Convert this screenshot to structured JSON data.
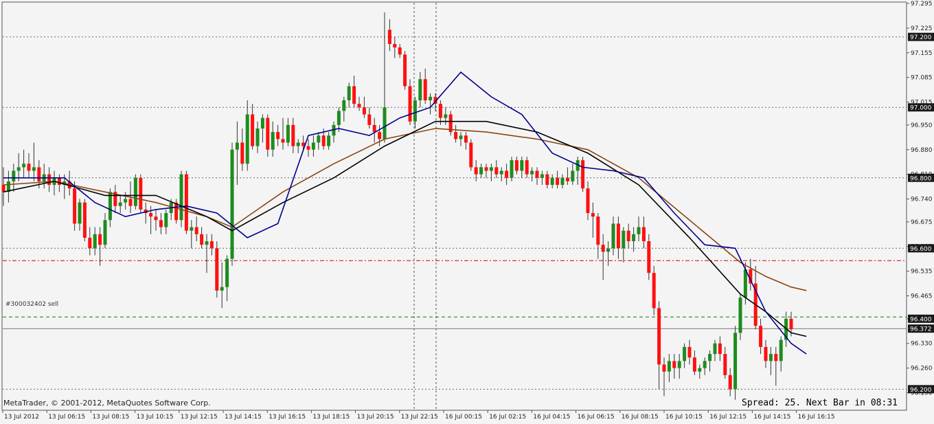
{
  "footer": {
    "copyright": "MetaTrader, © 2001-2012, MetaQuotes Software Corp.",
    "spread_status": "Spread: 25. Next Bar in 08:31"
  },
  "order_label": "#300032402 sell",
  "colors": {
    "background": "#f4f4f4",
    "bull_candle": "#1e8c1e",
    "bear_candle": "#ff1010",
    "ma_fast": "#00008b",
    "ma_slow": "#000000",
    "ma_brown": "#8b4513",
    "order_line": "#d00000",
    "sl_line": "#008000",
    "price_label_bg": "#1a1a1a"
  },
  "chart_data": {
    "type": "candlestick",
    "symbol_timeframe": "M15",
    "y_axis": {
      "min": 96.15,
      "max": 97.295,
      "ticks": [
        97.295,
        97.225,
        97.155,
        97.085,
        97.015,
        96.95,
        96.88,
        96.81,
        96.74,
        96.675,
        96.605,
        96.535,
        96.465,
        96.4,
        96.33,
        96.26,
        96.19
      ]
    },
    "price_labels": [
      {
        "value": "97.200",
        "level": 97.2
      },
      {
        "value": "97.000",
        "level": 97.0
      },
      {
        "value": "96.800",
        "level": 96.8
      },
      {
        "value": "96.600",
        "level": 96.6
      },
      {
        "value": "96.400",
        "level": 96.4
      },
      {
        "value": "96.372",
        "level": 96.372
      },
      {
        "value": "96.200",
        "level": 96.2
      }
    ],
    "horizontal_lines": [
      {
        "level": 97.2,
        "style": "dotted-gray"
      },
      {
        "level": 97.0,
        "style": "dotted-gray"
      },
      {
        "level": 96.8,
        "style": "dotted-gray"
      },
      {
        "level": 96.6,
        "style": "dotted-gray"
      },
      {
        "level": 96.565,
        "style": "dashdot-red"
      },
      {
        "level": 96.405,
        "style": "dashed-green"
      },
      {
        "level": 96.372,
        "style": "solid-gray"
      },
      {
        "level": 96.2,
        "style": "dotted-gray"
      }
    ],
    "x_labels": [
      "13 Jul 2012",
      "13 Jul 06:15",
      "13 Jul 08:15",
      "13 Jul 10:15",
      "13 Jul 12:15",
      "13 Jul 14:15",
      "13 Jul 16:15",
      "13 Jul 18:15",
      "13 Jul 20:15",
      "13 Jul 22:15",
      "16 Jul 00:15",
      "16 Jul 02:15",
      "16 Jul 04:15",
      "16 Jul 06:15",
      "16 Jul 08:15",
      "16 Jul 10:15",
      "16 Jul 12:15",
      "16 Jul 14:15",
      "16 Jul 16:15"
    ],
    "candles": [
      {
        "o": 96.78,
        "h": 96.83,
        "l": 96.72,
        "c": 96.76
      },
      {
        "o": 96.76,
        "h": 96.82,
        "l": 96.73,
        "c": 96.79
      },
      {
        "o": 96.79,
        "h": 96.84,
        "l": 96.76,
        "c": 96.82
      },
      {
        "o": 96.82,
        "h": 96.87,
        "l": 96.79,
        "c": 96.83
      },
      {
        "o": 96.83,
        "h": 96.88,
        "l": 96.8,
        "c": 96.84
      },
      {
        "o": 96.84,
        "h": 96.87,
        "l": 96.8,
        "c": 96.82
      },
      {
        "o": 96.82,
        "h": 96.9,
        "l": 96.79,
        "c": 96.83
      },
      {
        "o": 96.83,
        "h": 96.85,
        "l": 96.77,
        "c": 96.79
      },
      {
        "o": 96.79,
        "h": 96.84,
        "l": 96.77,
        "c": 96.81
      },
      {
        "o": 96.81,
        "h": 96.83,
        "l": 96.76,
        "c": 96.78
      },
      {
        "o": 96.78,
        "h": 96.82,
        "l": 96.75,
        "c": 96.8
      },
      {
        "o": 96.8,
        "h": 96.81,
        "l": 96.76,
        "c": 96.78
      },
      {
        "o": 96.78,
        "h": 96.81,
        "l": 96.74,
        "c": 96.79
      },
      {
        "o": 96.79,
        "h": 96.82,
        "l": 96.75,
        "c": 96.77
      },
      {
        "o": 96.77,
        "h": 96.79,
        "l": 96.65,
        "c": 96.67
      },
      {
        "o": 96.67,
        "h": 96.74,
        "l": 96.65,
        "c": 96.73
      },
      {
        "o": 96.73,
        "h": 96.74,
        "l": 96.62,
        "c": 96.63
      },
      {
        "o": 96.63,
        "h": 96.66,
        "l": 96.58,
        "c": 96.6
      },
      {
        "o": 96.6,
        "h": 96.66,
        "l": 96.58,
        "c": 96.64
      },
      {
        "o": 96.64,
        "h": 96.66,
        "l": 96.55,
        "c": 96.61
      },
      {
        "o": 96.61,
        "h": 96.7,
        "l": 96.6,
        "c": 96.68
      },
      {
        "o": 96.68,
        "h": 96.77,
        "l": 96.66,
        "c": 96.76
      },
      {
        "o": 96.76,
        "h": 96.78,
        "l": 96.7,
        "c": 96.72
      },
      {
        "o": 96.72,
        "h": 96.75,
        "l": 96.7,
        "c": 96.73
      },
      {
        "o": 96.73,
        "h": 96.76,
        "l": 96.71,
        "c": 96.74
      },
      {
        "o": 96.74,
        "h": 96.79,
        "l": 96.7,
        "c": 96.72
      },
      {
        "o": 96.72,
        "h": 96.81,
        "l": 96.71,
        "c": 96.8
      },
      {
        "o": 96.8,
        "h": 96.81,
        "l": 96.7,
        "c": 96.71
      },
      {
        "o": 96.71,
        "h": 96.73,
        "l": 96.67,
        "c": 96.7
      },
      {
        "o": 96.7,
        "h": 96.72,
        "l": 96.64,
        "c": 96.69
      },
      {
        "o": 96.69,
        "h": 96.71,
        "l": 96.65,
        "c": 96.68
      },
      {
        "o": 96.68,
        "h": 96.7,
        "l": 96.64,
        "c": 96.66
      },
      {
        "o": 96.66,
        "h": 96.71,
        "l": 96.64,
        "c": 96.7
      },
      {
        "o": 96.7,
        "h": 96.74,
        "l": 96.68,
        "c": 96.73
      },
      {
        "o": 96.73,
        "h": 96.74,
        "l": 96.67,
        "c": 96.68
      },
      {
        "o": 96.68,
        "h": 96.82,
        "l": 96.66,
        "c": 96.81
      },
      {
        "o": 96.81,
        "h": 96.82,
        "l": 96.64,
        "c": 96.65
      },
      {
        "o": 96.65,
        "h": 96.68,
        "l": 96.6,
        "c": 96.66
      },
      {
        "o": 96.66,
        "h": 96.69,
        "l": 96.62,
        "c": 96.64
      },
      {
        "o": 96.64,
        "h": 96.66,
        "l": 96.6,
        "c": 96.61
      },
      {
        "o": 96.61,
        "h": 96.64,
        "l": 96.53,
        "c": 96.62
      },
      {
        "o": 96.62,
        "h": 96.64,
        "l": 96.58,
        "c": 96.6
      },
      {
        "o": 96.6,
        "h": 96.62,
        "l": 96.46,
        "c": 96.48
      },
      {
        "o": 96.48,
        "h": 96.56,
        "l": 96.43,
        "c": 96.49
      },
      {
        "o": 96.49,
        "h": 96.58,
        "l": 96.45,
        "c": 96.57
      },
      {
        "o": 96.57,
        "h": 96.9,
        "l": 96.55,
        "c": 96.88
      },
      {
        "o": 96.88,
        "h": 96.96,
        "l": 96.78,
        "c": 96.9
      },
      {
        "o": 96.9,
        "h": 96.94,
        "l": 96.82,
        "c": 96.84
      },
      {
        "o": 96.84,
        "h": 97.02,
        "l": 96.82,
        "c": 96.98
      },
      {
        "o": 96.98,
        "h": 97.01,
        "l": 96.88,
        "c": 96.89
      },
      {
        "o": 96.89,
        "h": 96.96,
        "l": 96.87,
        "c": 96.94
      },
      {
        "o": 96.94,
        "h": 96.98,
        "l": 96.9,
        "c": 96.97
      },
      {
        "o": 96.97,
        "h": 96.98,
        "l": 96.86,
        "c": 96.88
      },
      {
        "o": 96.88,
        "h": 96.96,
        "l": 96.86,
        "c": 96.93
      },
      {
        "o": 96.93,
        "h": 96.95,
        "l": 96.89,
        "c": 96.91
      },
      {
        "o": 96.91,
        "h": 96.97,
        "l": 96.88,
        "c": 96.9
      },
      {
        "o": 96.9,
        "h": 96.97,
        "l": 96.89,
        "c": 96.95
      },
      {
        "o": 96.95,
        "h": 96.97,
        "l": 96.87,
        "c": 96.89
      },
      {
        "o": 96.89,
        "h": 96.91,
        "l": 96.87,
        "c": 96.9
      },
      {
        "o": 96.9,
        "h": 96.92,
        "l": 96.88,
        "c": 96.89
      },
      {
        "o": 96.89,
        "h": 96.91,
        "l": 96.86,
        "c": 96.88
      },
      {
        "o": 96.88,
        "h": 96.92,
        "l": 96.86,
        "c": 96.9
      },
      {
        "o": 96.9,
        "h": 96.93,
        "l": 96.88,
        "c": 96.92
      },
      {
        "o": 96.92,
        "h": 96.94,
        "l": 96.88,
        "c": 96.89
      },
      {
        "o": 96.89,
        "h": 96.93,
        "l": 96.88,
        "c": 96.92
      },
      {
        "o": 96.92,
        "h": 96.96,
        "l": 96.9,
        "c": 96.95
      },
      {
        "o": 96.95,
        "h": 97.0,
        "l": 96.93,
        "c": 96.99
      },
      {
        "o": 96.99,
        "h": 97.03,
        "l": 96.96,
        "c": 97.02
      },
      {
        "o": 97.02,
        "h": 97.07,
        "l": 97.0,
        "c": 97.06
      },
      {
        "o": 97.06,
        "h": 97.09,
        "l": 97.0,
        "c": 97.01
      },
      {
        "o": 97.01,
        "h": 97.03,
        "l": 96.99,
        "c": 97.0
      },
      {
        "o": 97.0,
        "h": 97.03,
        "l": 96.97,
        "c": 96.98
      },
      {
        "o": 96.98,
        "h": 97.0,
        "l": 96.94,
        "c": 96.95
      },
      {
        "o": 96.95,
        "h": 96.97,
        "l": 96.9,
        "c": 96.93
      },
      {
        "o": 96.93,
        "h": 96.95,
        "l": 96.89,
        "c": 96.91
      },
      {
        "o": 96.91,
        "h": 97.27,
        "l": 96.9,
        "c": 97.0
      },
      {
        "o": 97.22,
        "h": 97.25,
        "l": 97.16,
        "c": 97.18
      },
      {
        "o": 97.18,
        "h": 97.2,
        "l": 97.14,
        "c": 97.17
      },
      {
        "o": 97.17,
        "h": 97.18,
        "l": 97.14,
        "c": 97.15
      },
      {
        "o": 97.15,
        "h": 97.16,
        "l": 97.05,
        "c": 97.06
      },
      {
        "o": 97.06,
        "h": 97.08,
        "l": 96.95,
        "c": 96.96
      },
      {
        "o": 96.96,
        "h": 97.03,
        "l": 96.94,
        "c": 97.02
      },
      {
        "o": 97.02,
        "h": 97.1,
        "l": 97.0,
        "c": 97.08
      },
      {
        "o": 97.08,
        "h": 97.11,
        "l": 97.01,
        "c": 97.02
      },
      {
        "o": 97.02,
        "h": 97.04,
        "l": 96.98,
        "c": 97.03
      },
      {
        "o": 97.03,
        "h": 97.04,
        "l": 96.99,
        "c": 97.01
      },
      {
        "o": 97.01,
        "h": 97.02,
        "l": 96.95,
        "c": 96.97
      },
      {
        "o": 96.97,
        "h": 97.0,
        "l": 96.95,
        "c": 96.98
      },
      {
        "o": 96.98,
        "h": 96.99,
        "l": 96.92,
        "c": 96.93
      },
      {
        "o": 96.93,
        "h": 96.95,
        "l": 96.9,
        "c": 96.91
      },
      {
        "o": 96.91,
        "h": 96.93,
        "l": 96.89,
        "c": 96.92
      },
      {
        "o": 96.92,
        "h": 96.93,
        "l": 96.88,
        "c": 96.9
      },
      {
        "o": 96.9,
        "h": 96.91,
        "l": 96.82,
        "c": 96.83
      },
      {
        "o": 96.83,
        "h": 96.85,
        "l": 96.79,
        "c": 96.81
      },
      {
        "o": 96.81,
        "h": 96.84,
        "l": 96.8,
        "c": 96.83
      },
      {
        "o": 96.83,
        "h": 96.84,
        "l": 96.8,
        "c": 96.82
      },
      {
        "o": 96.82,
        "h": 96.84,
        "l": 96.79,
        "c": 96.83
      },
      {
        "o": 96.83,
        "h": 96.85,
        "l": 96.8,
        "c": 96.81
      },
      {
        "o": 96.81,
        "h": 96.83,
        "l": 96.79,
        "c": 96.82
      },
      {
        "o": 96.82,
        "h": 96.84,
        "l": 96.78,
        "c": 96.8
      },
      {
        "o": 96.8,
        "h": 96.86,
        "l": 96.79,
        "c": 96.85
      },
      {
        "o": 96.85,
        "h": 96.86,
        "l": 96.81,
        "c": 96.82
      },
      {
        "o": 96.82,
        "h": 96.86,
        "l": 96.8,
        "c": 96.85
      },
      {
        "o": 96.85,
        "h": 96.86,
        "l": 96.8,
        "c": 96.81
      },
      {
        "o": 96.81,
        "h": 96.83,
        "l": 96.79,
        "c": 96.82
      },
      {
        "o": 96.82,
        "h": 96.83,
        "l": 96.78,
        "c": 96.8
      },
      {
        "o": 96.8,
        "h": 96.82,
        "l": 96.78,
        "c": 96.81
      },
      {
        "o": 96.81,
        "h": 96.82,
        "l": 96.77,
        "c": 96.78
      },
      {
        "o": 96.78,
        "h": 96.81,
        "l": 96.77,
        "c": 96.8
      },
      {
        "o": 96.8,
        "h": 96.82,
        "l": 96.77,
        "c": 96.78
      },
      {
        "o": 96.78,
        "h": 96.81,
        "l": 96.77,
        "c": 96.8
      },
      {
        "o": 96.8,
        "h": 96.83,
        "l": 96.78,
        "c": 96.79
      },
      {
        "o": 96.79,
        "h": 96.84,
        "l": 96.78,
        "c": 96.82
      },
      {
        "o": 96.82,
        "h": 96.86,
        "l": 96.78,
        "c": 96.85
      },
      {
        "o": 96.85,
        "h": 96.86,
        "l": 96.76,
        "c": 96.77
      },
      {
        "o": 96.77,
        "h": 96.79,
        "l": 96.68,
        "c": 96.7
      },
      {
        "o": 96.7,
        "h": 96.73,
        "l": 96.63,
        "c": 96.69
      },
      {
        "o": 96.69,
        "h": 96.7,
        "l": 96.57,
        "c": 96.61
      },
      {
        "o": 96.61,
        "h": 96.64,
        "l": 96.51,
        "c": 96.59
      },
      {
        "o": 96.59,
        "h": 96.62,
        "l": 96.55,
        "c": 96.6
      },
      {
        "o": 96.6,
        "h": 96.69,
        "l": 96.58,
        "c": 96.67
      },
      {
        "o": 96.67,
        "h": 96.69,
        "l": 96.57,
        "c": 96.6
      },
      {
        "o": 96.6,
        "h": 96.66,
        "l": 96.56,
        "c": 96.65
      },
      {
        "o": 96.65,
        "h": 96.67,
        "l": 96.6,
        "c": 96.62
      },
      {
        "o": 96.62,
        "h": 96.66,
        "l": 96.59,
        "c": 96.64
      },
      {
        "o": 96.64,
        "h": 96.69,
        "l": 96.62,
        "c": 96.66
      },
      {
        "o": 96.66,
        "h": 96.69,
        "l": 96.6,
        "c": 96.62
      },
      {
        "o": 96.62,
        "h": 96.64,
        "l": 96.51,
        "c": 96.53
      },
      {
        "o": 96.53,
        "h": 96.55,
        "l": 96.41,
        "c": 96.43
      },
      {
        "o": 96.43,
        "h": 96.45,
        "l": 96.2,
        "c": 96.27
      },
      {
        "o": 96.27,
        "h": 96.29,
        "l": 96.18,
        "c": 96.25
      },
      {
        "o": 96.25,
        "h": 96.3,
        "l": 96.22,
        "c": 96.28
      },
      {
        "o": 96.28,
        "h": 96.3,
        "l": 96.23,
        "c": 96.26
      },
      {
        "o": 96.26,
        "h": 96.3,
        "l": 96.23,
        "c": 96.28
      },
      {
        "o": 96.28,
        "h": 96.33,
        "l": 96.26,
        "c": 96.32
      },
      {
        "o": 96.32,
        "h": 96.34,
        "l": 96.27,
        "c": 96.29
      },
      {
        "o": 96.29,
        "h": 96.31,
        "l": 96.24,
        "c": 96.25
      },
      {
        "o": 96.25,
        "h": 96.27,
        "l": 96.23,
        "c": 96.26
      },
      {
        "o": 96.26,
        "h": 96.29,
        "l": 96.24,
        "c": 96.28
      },
      {
        "o": 96.28,
        "h": 96.31,
        "l": 96.25,
        "c": 96.3
      },
      {
        "o": 96.3,
        "h": 96.34,
        "l": 96.28,
        "c": 96.33
      },
      {
        "o": 96.33,
        "h": 96.35,
        "l": 96.28,
        "c": 96.3
      },
      {
        "o": 96.3,
        "h": 96.32,
        "l": 96.23,
        "c": 96.24
      },
      {
        "o": 96.24,
        "h": 96.26,
        "l": 96.18,
        "c": 96.2
      },
      {
        "o": 96.2,
        "h": 96.38,
        "l": 96.17,
        "c": 96.36
      },
      {
        "o": 96.36,
        "h": 96.47,
        "l": 96.34,
        "c": 96.46
      },
      {
        "o": 96.46,
        "h": 96.56,
        "l": 96.44,
        "c": 96.54
      },
      {
        "o": 96.54,
        "h": 96.57,
        "l": 96.48,
        "c": 96.5
      },
      {
        "o": 96.5,
        "h": 96.55,
        "l": 96.37,
        "c": 96.38
      },
      {
        "o": 96.38,
        "h": 96.4,
        "l": 96.3,
        "c": 96.32
      },
      {
        "o": 96.32,
        "h": 96.34,
        "l": 96.26,
        "c": 96.28
      },
      {
        "o": 96.28,
        "h": 96.32,
        "l": 96.24,
        "c": 96.3
      },
      {
        "o": 96.3,
        "h": 96.32,
        "l": 96.21,
        "c": 96.28
      },
      {
        "o": 96.28,
        "h": 96.35,
        "l": 96.25,
        "c": 96.34
      },
      {
        "o": 96.34,
        "h": 96.42,
        "l": 96.32,
        "c": 96.4
      },
      {
        "o": 96.4,
        "h": 96.42,
        "l": 96.35,
        "c": 96.37
      }
    ],
    "ma_fast_x": [
      0,
      6,
      12,
      18,
      24,
      30,
      36,
      42,
      48,
      54,
      60,
      66,
      72,
      78,
      84,
      90,
      96,
      102,
      108,
      114,
      120,
      126,
      132,
      138,
      144,
      150,
      155,
      158
    ],
    "ma_fast": [
      96.8,
      96.8,
      96.8,
      96.73,
      96.69,
      96.71,
      96.72,
      96.7,
      96.63,
      96.67,
      96.92,
      96.94,
      96.92,
      96.97,
      97.0,
      97.1,
      97.03,
      96.98,
      96.87,
      96.83,
      96.82,
      96.8,
      96.7,
      96.61,
      96.6,
      96.42,
      96.33,
      96.3
    ],
    "ma_slow_x": [
      0,
      10,
      20,
      30,
      40,
      45,
      55,
      65,
      75,
      85,
      95,
      105,
      115,
      125,
      135,
      145,
      150,
      155,
      158
    ],
    "ma_slow": [
      96.76,
      96.79,
      96.75,
      96.75,
      96.69,
      96.65,
      96.73,
      96.8,
      96.89,
      96.96,
      96.96,
      96.93,
      96.87,
      96.78,
      96.63,
      96.47,
      96.42,
      96.36,
      96.35
    ],
    "ma_brown_x": [
      0,
      10,
      20,
      30,
      40,
      45,
      55,
      65,
      75,
      85,
      95,
      105,
      115,
      125,
      135,
      145,
      150,
      155,
      158
    ],
    "ma_brown": [
      96.78,
      96.79,
      96.76,
      96.73,
      96.69,
      96.66,
      96.76,
      96.84,
      96.91,
      96.94,
      96.93,
      96.91,
      96.88,
      96.8,
      96.68,
      96.56,
      96.52,
      96.49,
      96.48
    ]
  }
}
